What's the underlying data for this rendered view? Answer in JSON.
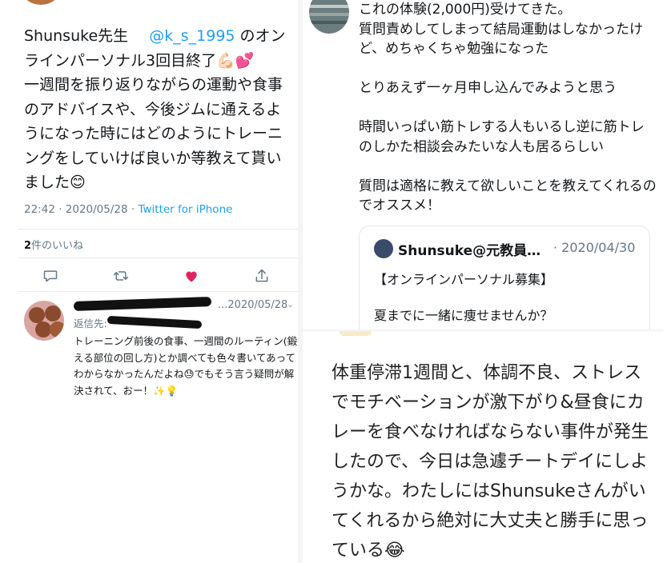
{
  "left_tweet": {
    "author": "Shunsuke先生",
    "handle": "@k_s_1995",
    "text_after_handle": " のオンラインパーソナル3回目終了💪🏻💕",
    "body": "一週間を振り返りながらの運動や食事のアドバイスや、今後ジムに通えるようになった時にはどのようにトレーニングをしていけば良いか等教えて貰いました😊",
    "time": "22:42 · 2020/05/28 · ",
    "via": "Twitter for iPhone",
    "likes_count": "2",
    "likes_label": "件のいいね"
  },
  "reply": {
    "date": "...2020/05/28",
    "chevron": "⌄",
    "reply_to_label": "返信先:",
    "text": "トレーニング前後の食事、一週間のルーティン(鍛える部位の回し方)とか調べても色々書いてあってわからなかったんだよね😓でもそう言う疑問が解決されて、おー！✨💡"
  },
  "right_tweet": {
    "lines": [
      "これの体験(2,000円)受けてきた。",
      "質問責めしてしまって結局運動はしなかったけど、めちゃくちゃ勉強になった",
      "",
      "とりあえず一ヶ月申し込んでみようと思う",
      "",
      "時間いっぱい筋トレする人もいるし逆に筋トレのしかた相談会みたいな人も居るらしい",
      "",
      "質問は適格に教えて欲しいことを教えてくれるのでオススメ！"
    ],
    "quote": {
      "name": "Shunsuke@元教員…",
      "date": "· 2020/04/30",
      "title": "【オンラインパーソナル募集】",
      "body": "夏までに一緒に痩せませんか？"
    }
  },
  "bottom_note": {
    "text": "体重停滞1週間と、体調不良、ストレスでモチベーションが激下がり&昼食にカレーを食べなければならない事件が発生したので、今日は急遽チートデイにしようかな。わたしにはShunsukeさんがいてくれるから絶対に大丈夫と勝手に思っている😂"
  },
  "icons": [
    "reply-icon",
    "retweet-icon",
    "heart-icon",
    "share-icon"
  ],
  "colors": {
    "link": "#1da1f2",
    "heart": "#e0245e",
    "muted": "#657786"
  }
}
